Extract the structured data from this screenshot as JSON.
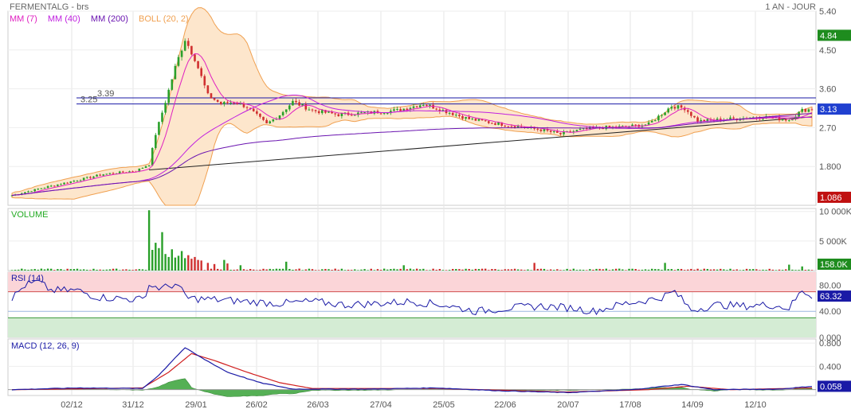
{
  "header": {
    "symbol_title": "FERMENTALG - brs",
    "period": "1 AN - JOUR"
  },
  "legend": [
    {
      "label": "MM (7)",
      "color": "#e020c0"
    },
    {
      "label": "MM (40)",
      "color": "#c020e0"
    },
    {
      "label": "MM (200)",
      "color": "#6a14b0"
    },
    {
      "label": "BOLL (20, 2)",
      "color": "#f0a050"
    }
  ],
  "panels": {
    "volume": {
      "label": "VOLUME",
      "color": "#22aa22"
    },
    "rsi": {
      "label": "RSI (14)",
      "color": "#1a1aa6"
    },
    "macd": {
      "label": "MACD (12, 26, 9)",
      "color": "#1a1aa6"
    }
  },
  "chart_data": [
    {
      "type": "candlestick",
      "panel": "price",
      "x_ticks": [
        "02/12",
        "31/12",
        "29/01",
        "26/02",
        "26/03",
        "27/04",
        "25/05",
        "22/06",
        "20/07",
        "17/08",
        "14/09",
        "12/10"
      ],
      "y_ticks": [
        "5.40",
        "4.50",
        "3.60",
        "2.70",
        "1.800"
      ],
      "ylim": [
        0.9,
        5.4
      ],
      "badges": [
        {
          "text": "4.84",
          "value": 4.84,
          "color": "#1e8c1e"
        },
        {
          "text": "3.13",
          "value": 3.13,
          "color": "#2040d0"
        },
        {
          "text": "1.086",
          "value": 1.086,
          "color": "#c01010"
        }
      ],
      "horizontal_lines": [
        {
          "label": "3.39",
          "value": 3.39
        },
        {
          "label": "3.25",
          "value": 3.25
        }
      ],
      "trendline": {
        "from": {
          "x": "31/12",
          "y": 1.72
        },
        "to": {
          "x": "last",
          "y": 2.95
        }
      },
      "close_keypoints": [
        [
          0,
          1.13
        ],
        [
          8,
          1.28
        ],
        [
          18,
          1.45
        ],
        [
          28,
          1.62
        ],
        [
          38,
          1.7
        ],
        [
          42,
          1.85
        ],
        [
          44,
          2.55
        ],
        [
          47,
          3.3
        ],
        [
          50,
          4.1
        ],
        [
          53,
          4.75
        ],
        [
          56,
          4.3
        ],
        [
          60,
          3.45
        ],
        [
          64,
          3.25
        ],
        [
          68,
          3.3
        ],
        [
          72,
          3.18
        ],
        [
          78,
          2.78
        ],
        [
          82,
          3.0
        ],
        [
          86,
          3.3
        ],
        [
          92,
          3.1
        ],
        [
          100,
          3.0
        ],
        [
          110,
          3.05
        ],
        [
          118,
          3.1
        ],
        [
          126,
          3.25
        ],
        [
          134,
          3.05
        ],
        [
          140,
          2.9
        ],
        [
          148,
          2.8
        ],
        [
          156,
          2.72
        ],
        [
          162,
          2.65
        ],
        [
          168,
          2.55
        ],
        [
          174,
          2.65
        ],
        [
          180,
          2.7
        ],
        [
          188,
          2.72
        ],
        [
          195,
          2.78
        ],
        [
          202,
          3.2
        ],
        [
          206,
          3.15
        ],
        [
          210,
          2.85
        ],
        [
          220,
          2.9
        ],
        [
          230,
          2.95
        ],
        [
          238,
          2.88
        ],
        [
          242,
          3.1
        ],
        [
          245,
          3.13
        ]
      ]
    },
    {
      "type": "bar",
      "panel": "volume",
      "y_ticks": [
        "10 000K",
        "5 000K"
      ],
      "ylim": [
        0,
        10500
      ],
      "badge": {
        "text": "158.0K",
        "value": 158.0,
        "color": "#1e8c1e"
      },
      "spikes": [
        [
          42,
          10200
        ],
        [
          43,
          3500
        ],
        [
          44,
          4700
        ],
        [
          45,
          3800
        ],
        [
          46,
          6500
        ],
        [
          47,
          2800
        ],
        [
          48,
          2300
        ],
        [
          49,
          3600
        ],
        [
          50,
          2200
        ],
        [
          51,
          2500
        ],
        [
          52,
          3300
        ],
        [
          53,
          2100
        ],
        [
          54,
          2600
        ],
        [
          55,
          2000
        ],
        [
          56,
          2300
        ],
        [
          57,
          1800
        ],
        [
          58,
          1700
        ],
        [
          60,
          1300
        ],
        [
          62,
          1100
        ],
        [
          65,
          1800
        ],
        [
          66,
          1200
        ],
        [
          70,
          900
        ],
        [
          84,
          1500
        ],
        [
          120,
          900
        ],
        [
          160,
          1300
        ],
        [
          200,
          1300
        ],
        [
          238,
          1000
        ],
        [
          242,
          700
        ]
      ]
    },
    {
      "type": "line",
      "panel": "rsi",
      "y_ticks": [
        "80.00",
        "40.00",
        "0.000"
      ],
      "ylim": [
        0,
        100
      ],
      "zones": {
        "overbought": 70,
        "oversold": 30,
        "mid": 40
      },
      "badge": {
        "text": "63.32",
        "value": 63.32,
        "color": "#1a1aa6"
      },
      "keypoints": [
        [
          0,
          60
        ],
        [
          4,
          80
        ],
        [
          8,
          85
        ],
        [
          12,
          72
        ],
        [
          20,
          72
        ],
        [
          26,
          62
        ],
        [
          32,
          60
        ],
        [
          40,
          58
        ],
        [
          42,
          80
        ],
        [
          46,
          75
        ],
        [
          50,
          82
        ],
        [
          54,
          60
        ],
        [
          62,
          58
        ],
        [
          72,
          55
        ],
        [
          82,
          52
        ],
        [
          92,
          55
        ],
        [
          102,
          50
        ],
        [
          112,
          52
        ],
        [
          122,
          55
        ],
        [
          132,
          50
        ],
        [
          142,
          40
        ],
        [
          152,
          45
        ],
        [
          162,
          48
        ],
        [
          172,
          45
        ],
        [
          178,
          40
        ],
        [
          188,
          52
        ],
        [
          198,
          60
        ],
        [
          203,
          70
        ],
        [
          208,
          42
        ],
        [
          216,
          50
        ],
        [
          224,
          48
        ],
        [
          232,
          50
        ],
        [
          238,
          45
        ],
        [
          242,
          72
        ],
        [
          245,
          63.32
        ]
      ]
    },
    {
      "type": "line",
      "panel": "macd",
      "y_ticks": [
        "0.800",
        "0.400"
      ],
      "ylim": [
        -0.1,
        0.87
      ],
      "badge": {
        "text": "0.058",
        "value": 0.058,
        "color": "#1a1aa6"
      },
      "macd_keypoints": [
        [
          0,
          0.0
        ],
        [
          20,
          0.03
        ],
        [
          40,
          0.02
        ],
        [
          45,
          0.25
        ],
        [
          50,
          0.55
        ],
        [
          53,
          0.72
        ],
        [
          58,
          0.55
        ],
        [
          66,
          0.3
        ],
        [
          76,
          0.12
        ],
        [
          86,
          0.01
        ],
        [
          110,
          0.01
        ],
        [
          130,
          0.03
        ],
        [
          150,
          -0.02
        ],
        [
          170,
          -0.05
        ],
        [
          190,
          0.0
        ],
        [
          205,
          0.09
        ],
        [
          215,
          0.0
        ],
        [
          235,
          0.01
        ],
        [
          245,
          0.058
        ]
      ],
      "signal_keypoints": [
        [
          0,
          0.0
        ],
        [
          40,
          0.03
        ],
        [
          48,
          0.3
        ],
        [
          55,
          0.62
        ],
        [
          62,
          0.5
        ],
        [
          72,
          0.3
        ],
        [
          82,
          0.12
        ],
        [
          92,
          0.02
        ],
        [
          130,
          0.02
        ],
        [
          170,
          -0.04
        ],
        [
          195,
          0.0
        ],
        [
          207,
          0.06
        ],
        [
          220,
          0.0
        ],
        [
          245,
          0.03
        ]
      ]
    }
  ]
}
